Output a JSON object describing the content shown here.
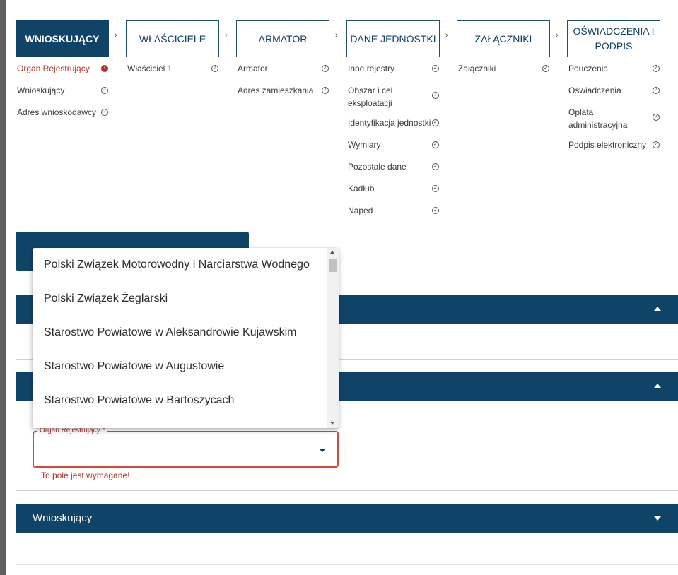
{
  "stepper": {
    "steps": [
      {
        "label": "WNIOSKUJĄCY",
        "active": true
      },
      {
        "label": "WŁAŚCICIELE",
        "active": false
      },
      {
        "label": "ARMATOR",
        "active": false
      },
      {
        "label": "DANE JEDNOSTKI",
        "active": false
      },
      {
        "label": "ZAŁĄCZNIKI",
        "active": false
      },
      {
        "label": "OŚWIADCZENIA I PODPIS",
        "active": false
      }
    ],
    "arrow": "›"
  },
  "substeps": {
    "wnioskujacy": [
      "Organ Rejestrujący",
      "Wnioskujący",
      "Adres wnioskodawcy"
    ],
    "wlasciciele": [
      "Właściciel 1"
    ],
    "armator": [
      "Armator",
      "Adres zamieszkania"
    ],
    "dane": [
      "Inne rejestry",
      "Obszar i cel eksploatacji",
      "Identyfikacja jednostki",
      "Wymiary",
      "Pozostałe dane",
      "Kadłub",
      "Napęd"
    ],
    "zalaczniki": [
      "Załączniki"
    ],
    "oswiadczenia": [
      "Pouczenia",
      "Oświadczenia",
      "Opłata administracyjna",
      "Podpis elektroniczny"
    ]
  },
  "icons": {
    "check": "check-circle-icon",
    "error": "error-circle-icon"
  },
  "dropdown": {
    "options": [
      "Polski Związek Motorowodny i Narciarstwa Wodnego",
      "Polski Związek Żeglarski",
      "Starostwo Powiatowe w Aleksandrowie Kujawskim",
      "Starostwo Powiatowe w Augustowie",
      "Starostwo Powiatowe w Bartoszycach"
    ]
  },
  "form": {
    "organ_label": "Organ Rejestrujący *",
    "organ_value": "",
    "error": "To pole jest wymagane!"
  },
  "sections": {
    "wnioskujacy_title": "Wnioskujący"
  },
  "colors": {
    "primary": "#0f4468",
    "error": "#b0302a"
  }
}
